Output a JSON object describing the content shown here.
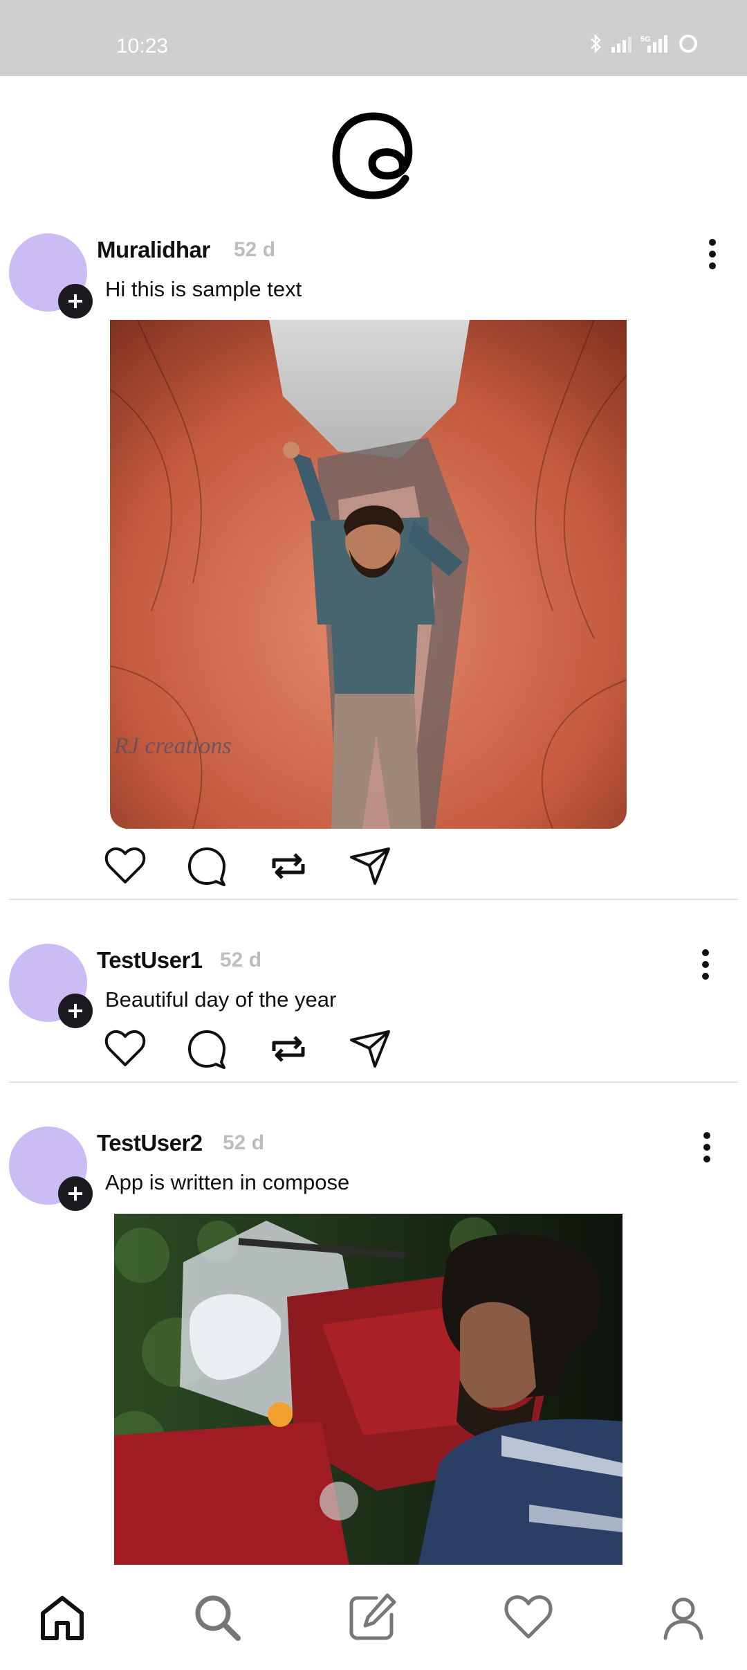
{
  "status_bar": {
    "time": "10:23",
    "icons": [
      "bluetooth-icon",
      "signal-icon",
      "5g-signal-icon",
      "battery-icon"
    ]
  },
  "app": {
    "logo": "threads-logo"
  },
  "posts": [
    {
      "username": "Muralidhar",
      "time_ago": "52 d",
      "text": "Hi this is sample text",
      "has_image": true,
      "image_watermark": "RJ creations"
    },
    {
      "username": "TestUser1",
      "time_ago": "52 d",
      "text": "Beautiful day of the year",
      "has_image": false
    },
    {
      "username": "TestUser2",
      "time_ago": "52 d",
      "text": "App is written in compose",
      "has_image": true
    }
  ],
  "bottom_nav": {
    "items": [
      "home-icon",
      "search-icon",
      "compose-icon",
      "activity-heart-icon",
      "profile-icon"
    ]
  },
  "colors": {
    "avatar": "#ccbcf6",
    "plus_badge": "#1b1b1f",
    "status_bar": "#cfcfcf",
    "time_ago": "#bdbdbd"
  }
}
